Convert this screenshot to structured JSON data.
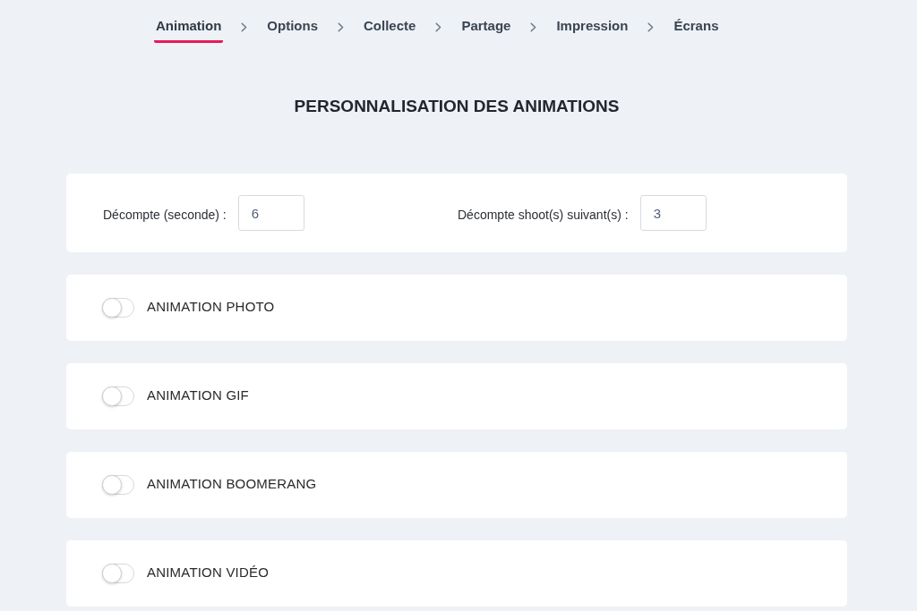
{
  "steps": [
    {
      "label": "Animation",
      "selected": true
    },
    {
      "label": "Options",
      "selected": false
    },
    {
      "label": "Collecte",
      "selected": false
    },
    {
      "label": "Partage",
      "selected": false
    },
    {
      "label": "Impression",
      "selected": false
    },
    {
      "label": "Écrans",
      "selected": false
    }
  ],
  "title": "PERSONNALISATION DES ANIMATIONS",
  "countdowns": [
    {
      "label": "Décompte (seconde) :",
      "value": "6"
    },
    {
      "label": "Décompte shoot(s) suivant(s) :",
      "value": "3"
    }
  ],
  "animations": [
    {
      "label": "ANIMATION PHOTO",
      "on": false
    },
    {
      "label": "ANIMATION GIF",
      "on": false
    },
    {
      "label": "ANIMATION BOOMERANG",
      "on": false
    },
    {
      "label": "ANIMATION VIDÉO",
      "on": false
    }
  ]
}
